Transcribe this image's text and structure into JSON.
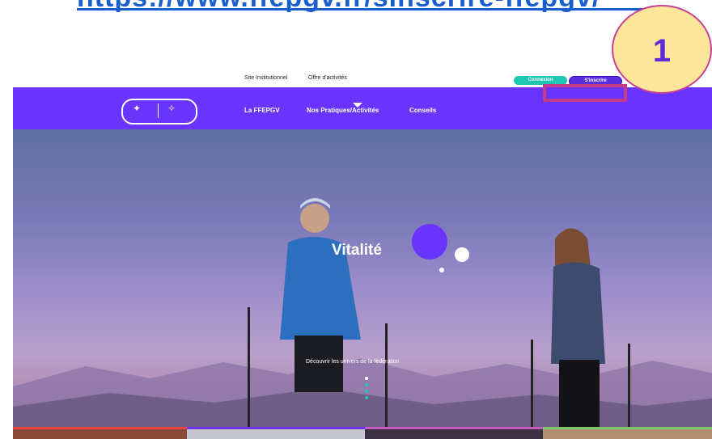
{
  "top_link": {
    "text": "https://www.ffepgv.fr/sinscrire-ffepgv/"
  },
  "utility_nav": {
    "links": [
      {
        "label": "Site Institutionnel"
      },
      {
        "label": "Offre d'activités"
      }
    ],
    "buttons": {
      "connexion": "Connexion",
      "inscrire": "S'inscrire"
    }
  },
  "main_nav": {
    "items": [
      {
        "label": "La FFEPGV"
      },
      {
        "label": "Nos Pratiques/Activités"
      },
      {
        "label": "Conseils"
      }
    ]
  },
  "hero": {
    "title": "Vitalité",
    "subtitle": "Découvrir les univers de la fédération"
  },
  "annotation": {
    "step_number": "1"
  },
  "colors": {
    "brand_purple": "#6a34ff",
    "teal": "#1fc6b4",
    "callout_pink": "#c43b8a",
    "badge_yellow": "#fde69a",
    "link_blue": "#1a5fd0"
  }
}
